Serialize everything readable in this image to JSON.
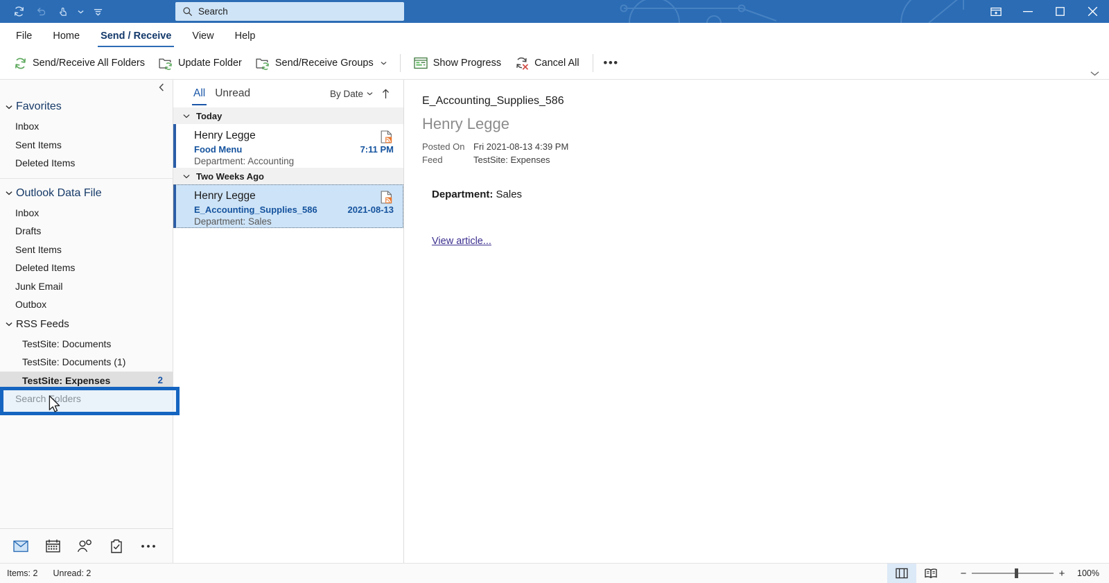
{
  "titlebar": {
    "quick_access": [
      {
        "name": "send-receive-all-icon",
        "label": "Send/Receive All Folders"
      },
      {
        "name": "undo-icon",
        "label": "Undo"
      },
      {
        "name": "touch-mode-icon",
        "label": "Touch/Mouse Mode"
      },
      {
        "name": "customize-qat-icon",
        "label": "Customize Quick Access Toolbar"
      }
    ],
    "search": {
      "placeholder": "Search",
      "value": "Search"
    },
    "window_controls": [
      {
        "name": "ribbon-display-options",
        "label": "Ribbon Display Options"
      },
      {
        "name": "minimize",
        "label": "Minimize"
      },
      {
        "name": "maximize",
        "label": "Maximize"
      },
      {
        "name": "close",
        "label": "Close"
      }
    ]
  },
  "tabs": [
    {
      "label": "File",
      "active": false
    },
    {
      "label": "Home",
      "active": false
    },
    {
      "label": "Send / Receive",
      "active": true
    },
    {
      "label": "View",
      "active": false
    },
    {
      "label": "Help",
      "active": false
    }
  ],
  "ribbon": {
    "items": [
      {
        "label": "Send/Receive All Folders",
        "icon": "refresh-icon",
        "caret": false
      },
      {
        "label": "Update Folder",
        "icon": "update-folder-icon",
        "caret": false
      },
      {
        "label": "Send/Receive Groups",
        "icon": "send-receive-groups-icon",
        "caret": true
      },
      {
        "label": "Show Progress",
        "icon": "show-progress-icon",
        "caret": false
      },
      {
        "label": "Cancel All",
        "icon": "cancel-all-icon",
        "caret": false
      }
    ],
    "overflow_label": "•••"
  },
  "folder_pane": {
    "favorites": {
      "title": "Favorites",
      "items": [
        {
          "label": "Inbox"
        },
        {
          "label": "Sent Items"
        },
        {
          "label": "Deleted Items"
        }
      ]
    },
    "data_file": {
      "title": "Outlook Data File",
      "items": [
        {
          "label": "Inbox",
          "sub": false,
          "selected": false,
          "count": ""
        },
        {
          "label": "Drafts",
          "sub": false,
          "selected": false,
          "count": ""
        },
        {
          "label": "Sent Items",
          "sub": false,
          "selected": false,
          "count": ""
        },
        {
          "label": "Deleted Items",
          "sub": false,
          "selected": false,
          "count": ""
        },
        {
          "label": "Junk Email",
          "sub": false,
          "selected": false,
          "count": ""
        },
        {
          "label": "Outbox",
          "sub": false,
          "selected": false,
          "count": ""
        }
      ],
      "rss_group": {
        "label": "RSS Feeds",
        "highlighted": true
      },
      "rss_items": [
        {
          "label": "TestSite: Documents",
          "sub": true,
          "selected": false,
          "count": ""
        },
        {
          "label": "TestSite: Documents (1)",
          "sub": true,
          "selected": false,
          "count": ""
        },
        {
          "label": "TestSite: Expenses",
          "sub": true,
          "selected": true,
          "count": "2"
        }
      ],
      "trailing": [
        {
          "label": "Search Folders",
          "sub": false,
          "selected": false,
          "count": ""
        }
      ]
    },
    "nav_icons": [
      {
        "name": "mail-icon",
        "label": "Mail",
        "active": true
      },
      {
        "name": "calendar-icon",
        "label": "Calendar",
        "active": false
      },
      {
        "name": "people-icon",
        "label": "People",
        "active": false
      },
      {
        "name": "tasks-icon",
        "label": "Tasks",
        "active": false
      },
      {
        "name": "more-nav-icon",
        "label": "More",
        "active": false
      }
    ]
  },
  "message_list": {
    "filters": [
      {
        "label": "All",
        "active": true
      },
      {
        "label": "Unread",
        "active": false
      }
    ],
    "sort_label": "By Date",
    "sort_direction_icon": "arrow-up-icon",
    "groups": [
      {
        "title": "Today",
        "messages": [
          {
            "from": "Henry Legge",
            "subject": "Food Menu",
            "date": "7:11 PM",
            "preview": "Department: Accounting",
            "selected": false,
            "unread": true,
            "icon": "rss-document-icon"
          }
        ]
      },
      {
        "title": "Two Weeks Ago",
        "messages": [
          {
            "from": "Henry Legge",
            "subject": "E_Accounting_Supplies_586",
            "date": "2021-08-13",
            "preview": "Department: Sales",
            "selected": true,
            "unread": true,
            "icon": "rss-document-icon"
          }
        ]
      }
    ]
  },
  "reading_pane": {
    "subject": "E_Accounting_Supplies_586",
    "sender": "Henry Legge",
    "meta": [
      {
        "label": "Posted On",
        "value": "Fri 2021-08-13 4:39 PM"
      },
      {
        "label": "Feed",
        "value": "TestSite: Expenses"
      }
    ],
    "body_label": "Department:",
    "body_value": "Sales",
    "link_label": "View article..."
  },
  "status_bar": {
    "items_label": "Items: 2",
    "unread_label": "Unread: 2",
    "view_normal": "normal-view-icon",
    "view_reading": "reading-view-icon",
    "zoom_minus": "−",
    "zoom_plus": "+",
    "zoom_level": "100%"
  },
  "colors": {
    "titlebar": "#2B6CB5",
    "accent": "#1a56a8",
    "selection": "#CDE3F7",
    "highlight_box": "#1565C0",
    "link": "#3b2f8f",
    "rss_orange": "#E8762C"
  }
}
